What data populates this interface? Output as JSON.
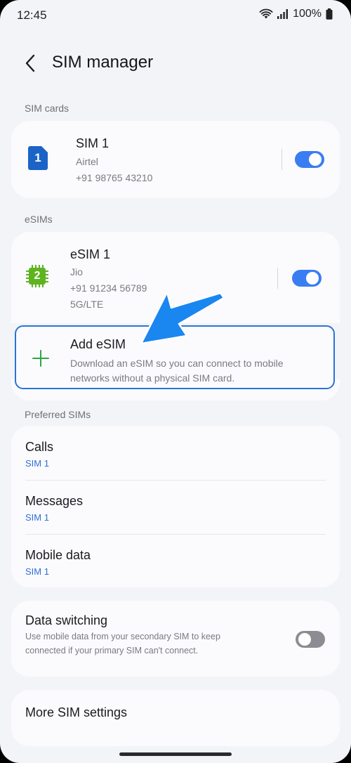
{
  "status_bar": {
    "time": "12:45",
    "battery": "100%",
    "icons": [
      "wifi-icon",
      "signal-icon",
      "battery-icon"
    ]
  },
  "header": {
    "back_icon": "back-arrow-icon",
    "title": "SIM manager"
  },
  "sim_cards": {
    "section_label": "SIM cards",
    "items": [
      {
        "badge": "1",
        "name": "SIM 1",
        "carrier": "Airtel",
        "number": "+91 98765 43210",
        "enabled": true
      }
    ]
  },
  "esims": {
    "section_label": "eSIMs",
    "items": [
      {
        "badge": "2",
        "name": "eSIM 1",
        "carrier": "Jio",
        "number": "+91 91234 56789",
        "network": "5G/LTE",
        "enabled": true
      }
    ],
    "add": {
      "title": "Add eSIM",
      "description": "Download an eSIM so you can connect to mobile networks without a physical SIM card."
    }
  },
  "preferred_sims": {
    "section_label": "Preferred SIMs",
    "items": [
      {
        "title": "Calls",
        "value": "SIM 1"
      },
      {
        "title": "Messages",
        "value": "SIM 1"
      },
      {
        "title": "Mobile data",
        "value": "SIM 1"
      }
    ]
  },
  "data_switching": {
    "title": "Data switching",
    "description": "Use mobile data from your secondary SIM to keep connected if your primary SIM can't connect.",
    "enabled": false
  },
  "more_settings": {
    "label": "More SIM settings"
  },
  "colors": {
    "accent": "#3a7df2",
    "link": "#2e6fd6",
    "highlight_border": "#2a73d9",
    "sim1_badge": "#1b63c6",
    "esim_badge": "#5fb31f",
    "annotation_arrow": "#1a86f0"
  }
}
